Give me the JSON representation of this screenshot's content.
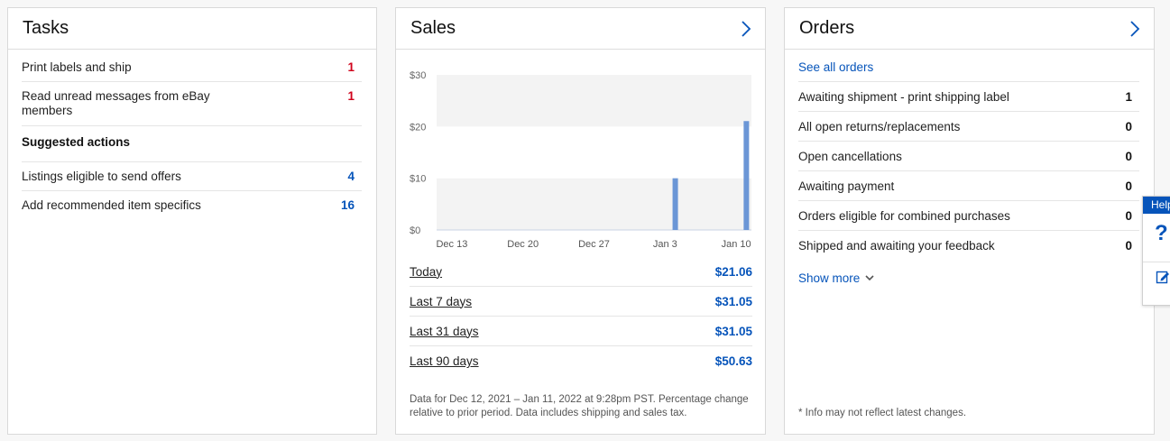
{
  "tasks": {
    "title": "Tasks",
    "items": [
      {
        "label": "Print labels and ship",
        "count": "1"
      },
      {
        "label": "Read unread messages from eBay members",
        "count": "1"
      }
    ],
    "suggested_title": "Suggested actions",
    "suggested": [
      {
        "label": "Listings eligible to send offers",
        "count": "4"
      },
      {
        "label": "Add recommended item specifics",
        "count": "16"
      }
    ]
  },
  "sales": {
    "title": "Sales",
    "periods": [
      {
        "label": "Today",
        "amount": "$21.06"
      },
      {
        "label": "Last 7 days",
        "amount": "$31.05"
      },
      {
        "label": "Last 31 days",
        "amount": "$31.05"
      },
      {
        "label": "Last 90 days",
        "amount": "$50.63"
      }
    ],
    "note": "Data for Dec 12, 2021 – Jan 11, 2022 at 9:28pm PST. Percentage change relative to prior period. Data includes shipping and sales tax."
  },
  "chart_data": {
    "type": "bar",
    "x_ticks": [
      "Dec 13",
      "Dec 20",
      "Dec 27",
      "Jan 3",
      "Jan 10"
    ],
    "y_ticks": [
      "$0",
      "$10",
      "$20",
      "$30"
    ],
    "ylim": [
      0,
      30
    ],
    "x_start": "Dec 12",
    "days": 31,
    "bars": [
      {
        "date": "Jan 4",
        "value": 10
      },
      {
        "date": "Jan 11",
        "value": 21.06
      }
    ],
    "bar_color": "#6b96d6",
    "band_color": "#f3f3f3"
  },
  "orders": {
    "title": "Orders",
    "see_all": "See all orders",
    "items": [
      {
        "label": "Awaiting shipment - print shipping label",
        "count": "1"
      },
      {
        "label": "All open returns/replacements",
        "count": "0"
      },
      {
        "label": "Open cancellations",
        "count": "0"
      },
      {
        "label": "Awaiting payment",
        "count": "0"
      },
      {
        "label": "Orders eligible for combined purchases",
        "count": "0"
      },
      {
        "label": "Shipped and awaiting your feedback",
        "count": "0"
      }
    ],
    "show_more": "Show more",
    "info_note": "* Info may not reflect latest changes."
  },
  "help": {
    "label": "Help",
    "question_mark": "?"
  },
  "colors": {
    "accent": "#0654ba",
    "alert": "#d0021b"
  }
}
